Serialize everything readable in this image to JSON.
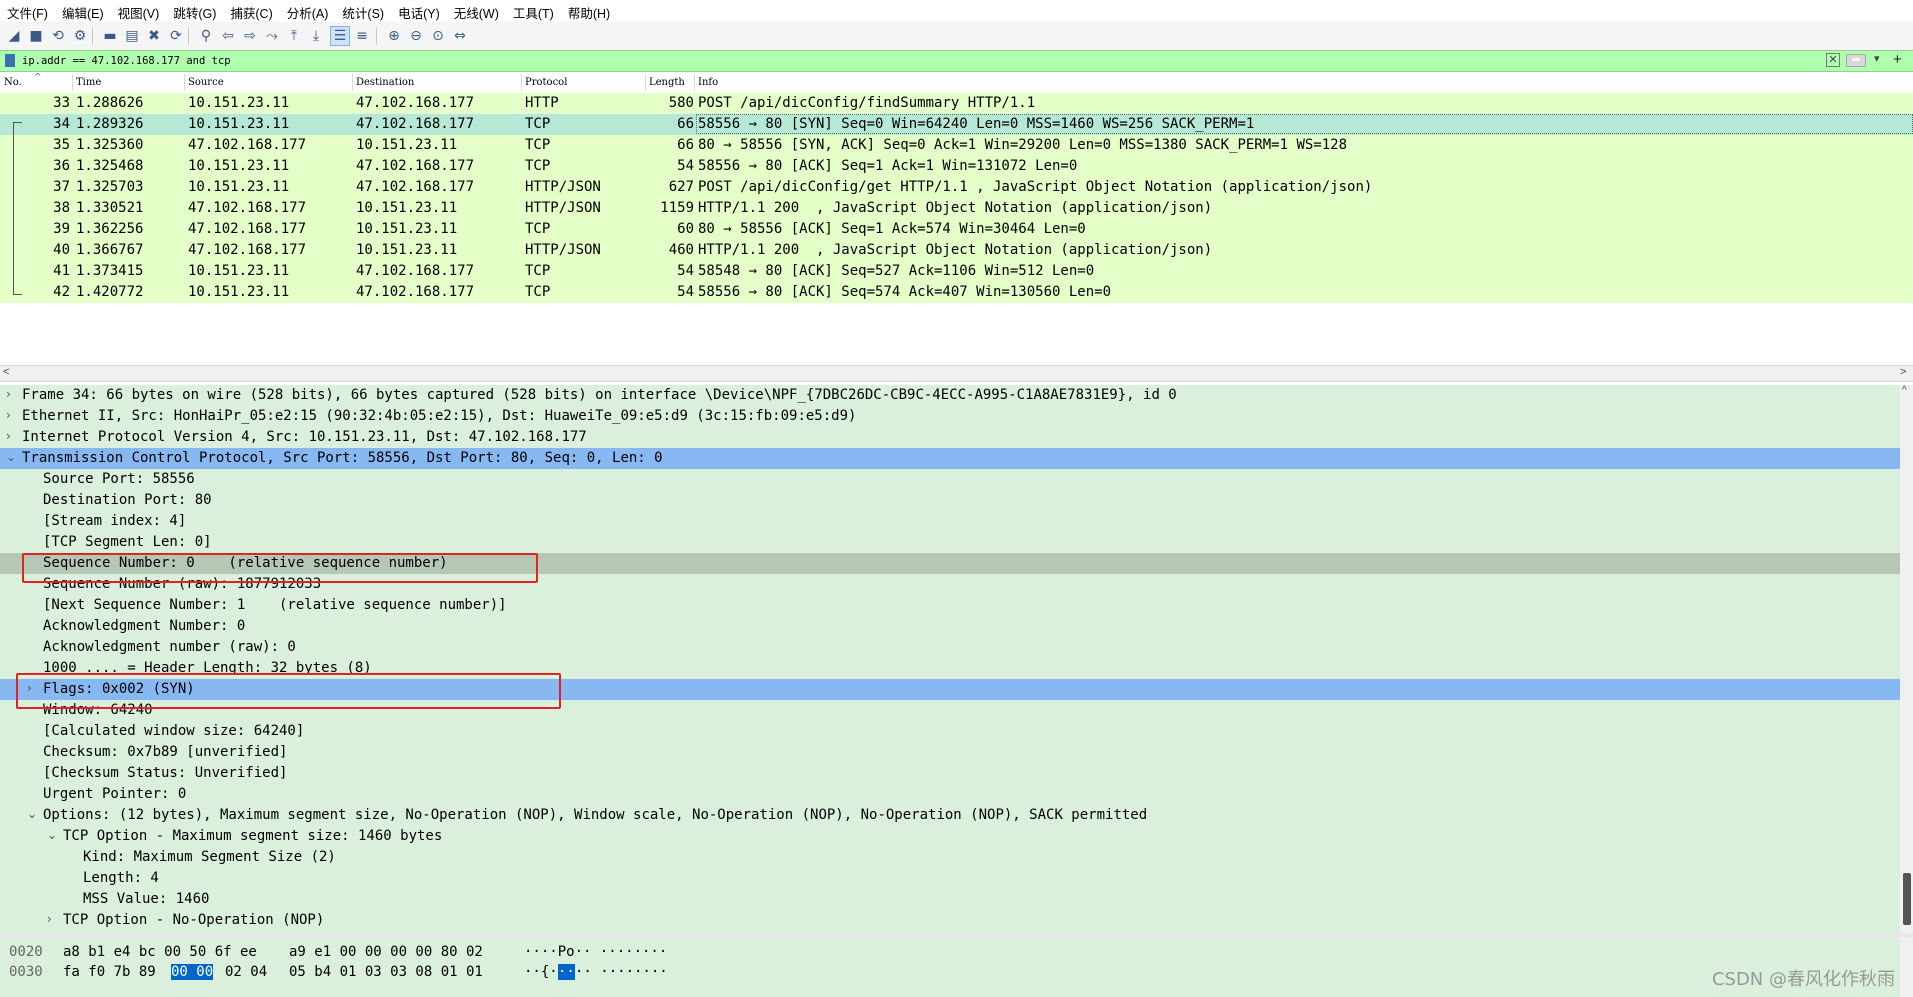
{
  "menu": [
    "文件(F)",
    "编辑(E)",
    "视图(V)",
    "跳转(G)",
    "捕获(C)",
    "分析(A)",
    "统计(S)",
    "电话(Y)",
    "无线(W)",
    "工具(T)",
    "帮助(H)"
  ],
  "toolbar_icons": [
    "shark-fin-start-icon",
    "stop-icon",
    "restart-icon",
    "options-gear-icon",
    "open-file-icon",
    "save-icon",
    "close-file-icon",
    "reload-icon",
    "find-icon",
    "back-icon",
    "forward-icon",
    "go-to-packet-icon",
    "first-packet-icon",
    "last-packet-icon",
    "autoscroll-icon",
    "colorize-icon",
    "zoom-in-icon",
    "zoom-out-icon",
    "zoom-normal-icon",
    "resize-columns-icon"
  ],
  "filter": {
    "value": "ip.addr == 47.102.168.177 and tcp"
  },
  "packet_list": {
    "columns": [
      "No.",
      "Time",
      "Source",
      "Destination",
      "Protocol",
      "Length",
      "Info"
    ],
    "rows": [
      {
        "no": "33",
        "time": "1.288626",
        "src": "10.151.23.11",
        "dst": "47.102.168.177",
        "proto": "HTTP",
        "len": "580",
        "info": "POST /api/dicConfig/findSummary HTTP/1.1"
      },
      {
        "no": "34",
        "time": "1.289326",
        "src": "10.151.23.11",
        "dst": "47.102.168.177",
        "proto": "TCP",
        "len": "66",
        "info": "58556 → 80 [SYN] Seq=0 Win=64240 Len=0 MSS=1460 WS=256 SACK_PERM=1"
      },
      {
        "no": "35",
        "time": "1.325360",
        "src": "47.102.168.177",
        "dst": "10.151.23.11",
        "proto": "TCP",
        "len": "66",
        "info": "80 → 58556 [SYN, ACK] Seq=0 Ack=1 Win=29200 Len=0 MSS=1380 SACK_PERM=1 WS=128"
      },
      {
        "no": "36",
        "time": "1.325468",
        "src": "10.151.23.11",
        "dst": "47.102.168.177",
        "proto": "TCP",
        "len": "54",
        "info": "58556 → 80 [ACK] Seq=1 Ack=1 Win=131072 Len=0"
      },
      {
        "no": "37",
        "time": "1.325703",
        "src": "10.151.23.11",
        "dst": "47.102.168.177",
        "proto": "HTTP/JSON",
        "len": "627",
        "info": "POST /api/dicConfig/get HTTP/1.1 , JavaScript Object Notation (application/json)"
      },
      {
        "no": "38",
        "time": "1.330521",
        "src": "47.102.168.177",
        "dst": "10.151.23.11",
        "proto": "HTTP/JSON",
        "len": "1159",
        "info": "HTTP/1.1 200  , JavaScript Object Notation (application/json)"
      },
      {
        "no": "39",
        "time": "1.362256",
        "src": "47.102.168.177",
        "dst": "10.151.23.11",
        "proto": "TCP",
        "len": "60",
        "info": "80 → 58556 [ACK] Seq=1 Ack=574 Win=30464 Len=0"
      },
      {
        "no": "40",
        "time": "1.366767",
        "src": "47.102.168.177",
        "dst": "10.151.23.11",
        "proto": "HTTP/JSON",
        "len": "460",
        "info": "HTTP/1.1 200  , JavaScript Object Notation (application/json)"
      },
      {
        "no": "41",
        "time": "1.373415",
        "src": "10.151.23.11",
        "dst": "47.102.168.177",
        "proto": "TCP",
        "len": "54",
        "info": "58548 → 80 [ACK] Seq=527 Ack=1106 Win=512 Len=0"
      },
      {
        "no": "42",
        "time": "1.420772",
        "src": "10.151.23.11",
        "dst": "47.102.168.177",
        "proto": "TCP",
        "len": "54",
        "info": "58556 → 80 [ACK] Seq=574 Ack=407 Win=130560 Len=0"
      }
    ]
  },
  "details": {
    "rows": [
      {
        "indent": 0,
        "arrow": ">",
        "text": "Frame 34: 66 bytes on wire (528 bits), 66 bytes captured (528 bits) on interface \\Device\\NPF_{7DBC26DC-CB9C-4ECC-A995-C1A8AE7831E9}, id 0"
      },
      {
        "indent": 0,
        "arrow": ">",
        "text": "Ethernet II, Src: HonHaiPr_05:e2:15 (90:32:4b:05:e2:15), Dst: HuaweiTe_09:e5:d9 (3c:15:fb:09:e5:d9)"
      },
      {
        "indent": 0,
        "arrow": ">",
        "text": "Internet Protocol Version 4, Src: 10.151.23.11, Dst: 47.102.168.177"
      },
      {
        "indent": 0,
        "arrow": "v",
        "text": "Transmission Control Protocol, Src Port: 58556, Dst Port: 80, Seq: 0, Len: 0",
        "hl": "hl"
      },
      {
        "indent": 1,
        "arrow": "",
        "text": "Source Port: 58556"
      },
      {
        "indent": 1,
        "arrow": "",
        "text": "Destination Port: 80"
      },
      {
        "indent": 1,
        "arrow": "",
        "text": "[Stream index: 4]"
      },
      {
        "indent": 1,
        "arrow": "",
        "text": "[TCP Segment Len: 0]"
      },
      {
        "indent": 1,
        "arrow": "",
        "text": "Sequence Number: 0    (relative sequence number)",
        "hl": "hl2"
      },
      {
        "indent": 1,
        "arrow": "",
        "text": "Sequence Number (raw): 1877912033"
      },
      {
        "indent": 1,
        "arrow": "",
        "text": "[Next Sequence Number: 1    (relative sequence number)]"
      },
      {
        "indent": 1,
        "arrow": "",
        "text": "Acknowledgment Number: 0"
      },
      {
        "indent": 1,
        "arrow": "",
        "text": "Acknowledgment number (raw): 0"
      },
      {
        "indent": 1,
        "arrow": "",
        "text": "1000 .... = Header Length: 32 bytes (8)"
      },
      {
        "indent": 1,
        "arrow": ">",
        "text": "Flags: 0x002 (SYN)",
        "hl": "hl"
      },
      {
        "indent": 1,
        "arrow": "",
        "text": "Window: 64240"
      },
      {
        "indent": 1,
        "arrow": "",
        "text": "[Calculated window size: 64240]"
      },
      {
        "indent": 1,
        "arrow": "",
        "text": "Checksum: 0x7b89 [unverified]"
      },
      {
        "indent": 1,
        "arrow": "",
        "text": "[Checksum Status: Unverified]"
      },
      {
        "indent": 1,
        "arrow": "",
        "text": "Urgent Pointer: 0"
      },
      {
        "indent": 1,
        "arrow": "v",
        "text": "Options: (12 bytes), Maximum segment size, No-Operation (NOP), Window scale, No-Operation (NOP), No-Operation (NOP), SACK permitted"
      },
      {
        "indent": 2,
        "arrow": "v",
        "text": "TCP Option - Maximum segment size: 1460 bytes"
      },
      {
        "indent": 3,
        "arrow": "",
        "text": "Kind: Maximum Segment Size (2)"
      },
      {
        "indent": 3,
        "arrow": "",
        "text": "Length: 4"
      },
      {
        "indent": 3,
        "arrow": "",
        "text": "MSS Value: 1460"
      },
      {
        "indent": 2,
        "arrow": ">",
        "text": "TCP Option - No-Operation (NOP)"
      }
    ]
  },
  "bytes": {
    "rows": [
      {
        "offset": "0020",
        "hex_a": "a8 b1 e4 bc 00 50 6f ee",
        "hex_b": "a9 e1 00 00 00 00 80 02",
        "ascii": "····Po·· ········"
      },
      {
        "offset": "0030",
        "hex_a_pre": "fa f0 7b 89",
        "hex_a_sel": "00 00",
        "hex_a_post": "02 04",
        "hex_b": "05 b4 01 03 03 08 01 01",
        "ascii_pre": "··{·",
        "ascii_sel": "··",
        "ascii_post": "·· ········"
      }
    ]
  },
  "watermark": "CSDN @春风化作秋雨",
  "colors": {
    "filter_bg": "#afffaf",
    "packet_row": "#e4ffc7",
    "packet_selected": "#b5e8d5",
    "details_bg": "#daf0dc",
    "highlight": "#87b8f2",
    "annotation_red": "#e02424"
  }
}
